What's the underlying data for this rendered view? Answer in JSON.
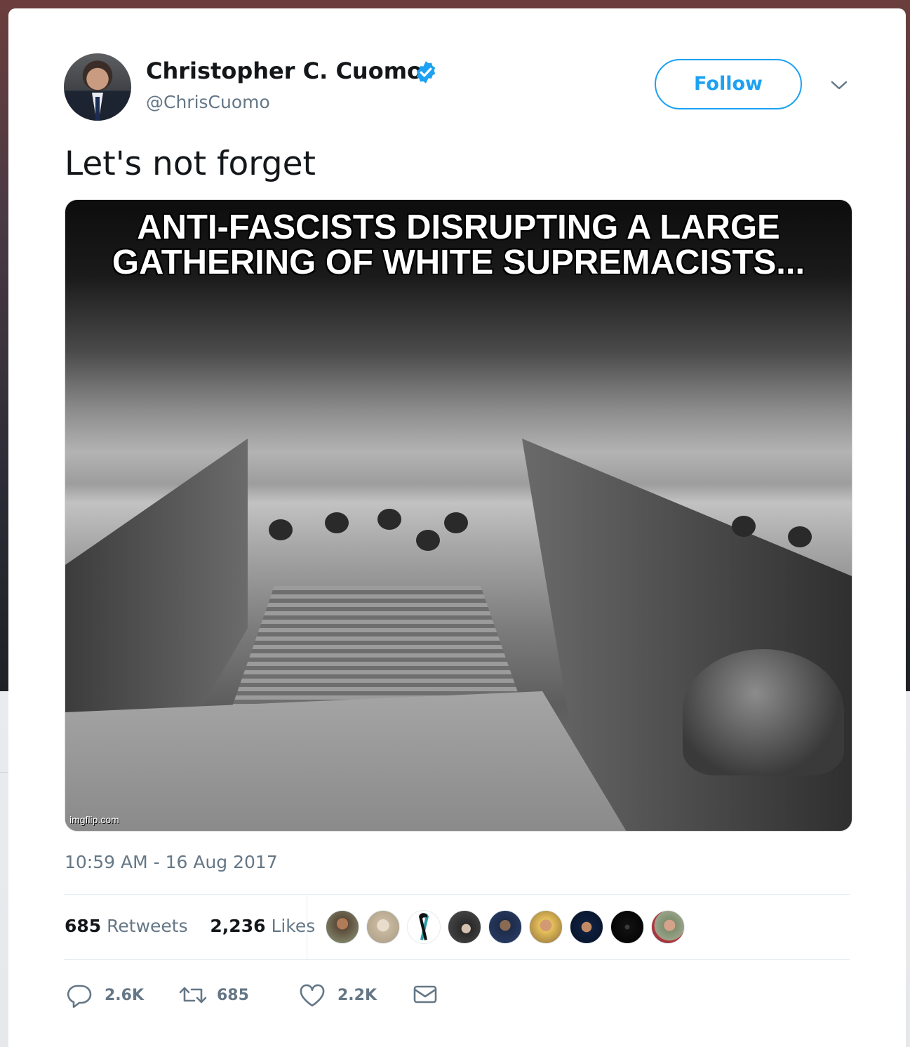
{
  "tweet": {
    "author_name": "Christopher C. Cuomo",
    "author_handle": "@ChrisCuomo",
    "follow_label": "Follow",
    "text": "Let's not forget",
    "timestamp": "10:59 AM - 16 Aug 2017",
    "media": {
      "caption_line1": "ANTI-FASCISTS DISRUPTING A LARGE",
      "caption_line2": "GATHERING OF WHITE SUPREMACISTS...",
      "watermark": "imgflip.com"
    },
    "stats": {
      "retweets_count": "685",
      "retweets_label": "Retweets",
      "likes_count": "2,236",
      "likes_label": "Likes"
    },
    "actions": {
      "reply_count": "2.6K",
      "retweet_count": "685",
      "like_count": "2.2K"
    },
    "likers_count_shown": 9
  },
  "icons": [
    "verified-badge-icon",
    "chevron-down-icon",
    "reply-icon",
    "retweet-icon",
    "heart-icon",
    "direct-message-icon"
  ],
  "colors": {
    "accent": "#1da1f2",
    "text_primary": "#14171a",
    "text_secondary": "#657786",
    "divider": "#e6ecf0"
  }
}
